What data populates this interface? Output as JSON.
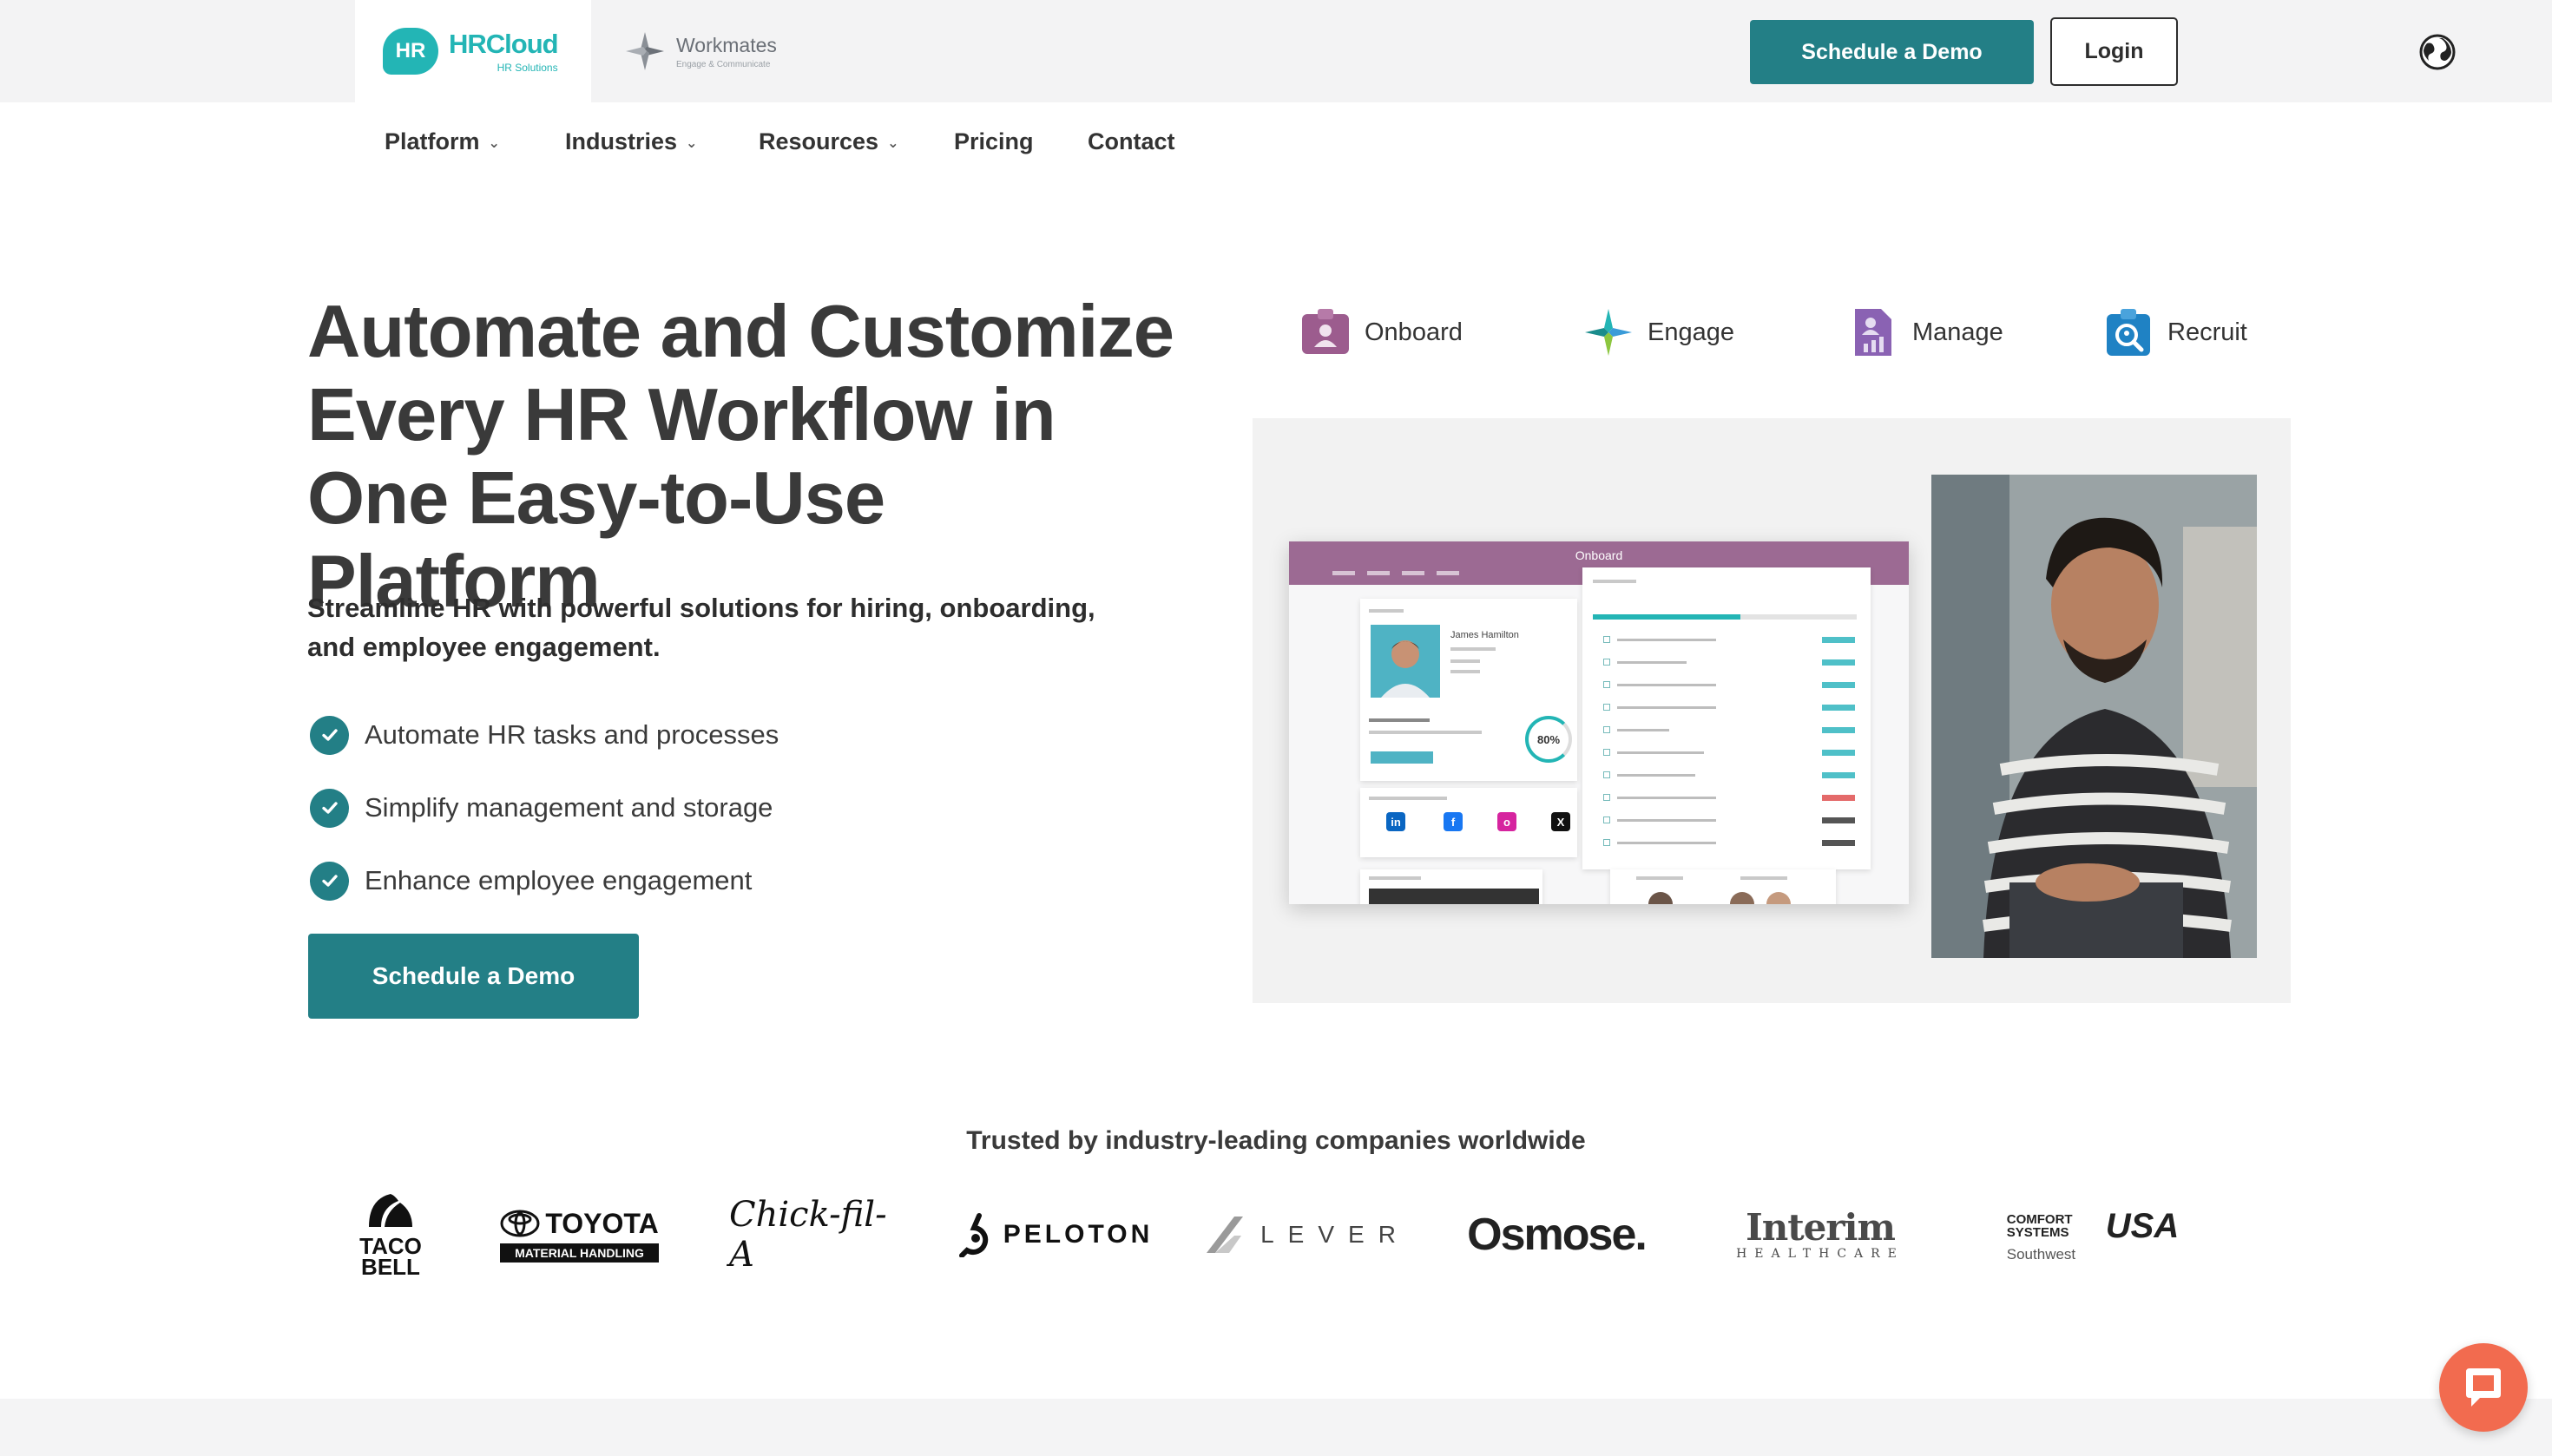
{
  "brand": {
    "hr_badge": "HR",
    "hr_name": "HRCloud",
    "hr_sub": "HR Solutions",
    "workmates_name": "Workmates",
    "workmates_sub": "Engage & Communicate"
  },
  "topbar": {
    "demo_label": "Schedule a Demo",
    "login_label": "Login"
  },
  "nav": {
    "items": [
      {
        "label": "Platform",
        "has_dropdown": true
      },
      {
        "label": "Industries",
        "has_dropdown": true
      },
      {
        "label": "Resources",
        "has_dropdown": true
      },
      {
        "label": "Pricing",
        "has_dropdown": false
      },
      {
        "label": "Contact",
        "has_dropdown": false
      }
    ]
  },
  "hero": {
    "title_line1": "Automate and Customize",
    "title_line2": "Every HR Workflow in",
    "title_line3": "One Easy-to-Use Platform",
    "subtitle": "Streamline HR with powerful solutions for hiring, onboarding, and employee engagement.",
    "checklist": [
      "Automate HR tasks and processes",
      "Simplify management and storage",
      "Enhance employee engagement"
    ],
    "cta_label": "Schedule a Demo"
  },
  "products": {
    "tabs": [
      {
        "label": "Onboard",
        "icon": "onboard-icon"
      },
      {
        "label": "Engage",
        "icon": "engage-icon"
      },
      {
        "label": "Manage",
        "icon": "manage-icon"
      },
      {
        "label": "Recruit",
        "icon": "recruit-icon"
      }
    ]
  },
  "preview": {
    "header": "Onboard",
    "profile_name": "James Hamilton",
    "completion": "80%"
  },
  "trusted": {
    "heading": "Trusted by industry-leading companies worldwide",
    "logos": [
      {
        "name": "taco-bell-logo",
        "line1": "TACO",
        "line2": "BELL"
      },
      {
        "name": "toyota-logo",
        "line1": "TOYOTA",
        "line2": "MATERIAL HANDLING"
      },
      {
        "name": "chick-fil-a-logo",
        "line1": "Chick-fil-A"
      },
      {
        "name": "peloton-logo",
        "line1": "PELOTON"
      },
      {
        "name": "lever-logo",
        "line1": "LEVER"
      },
      {
        "name": "osmose-logo",
        "line1": "Osmose."
      },
      {
        "name": "interim-logo",
        "line1": "Interim",
        "line2": "HEALTHCARE"
      },
      {
        "name": "comfort-systems-logo",
        "line1": "COMFORT SYSTEMS",
        "line2": "USA",
        "line3": "Southwest"
      }
    ]
  },
  "colors": {
    "teal": "#237f86",
    "brand_teal": "#23b5b5",
    "chat": "#f26b4f"
  }
}
